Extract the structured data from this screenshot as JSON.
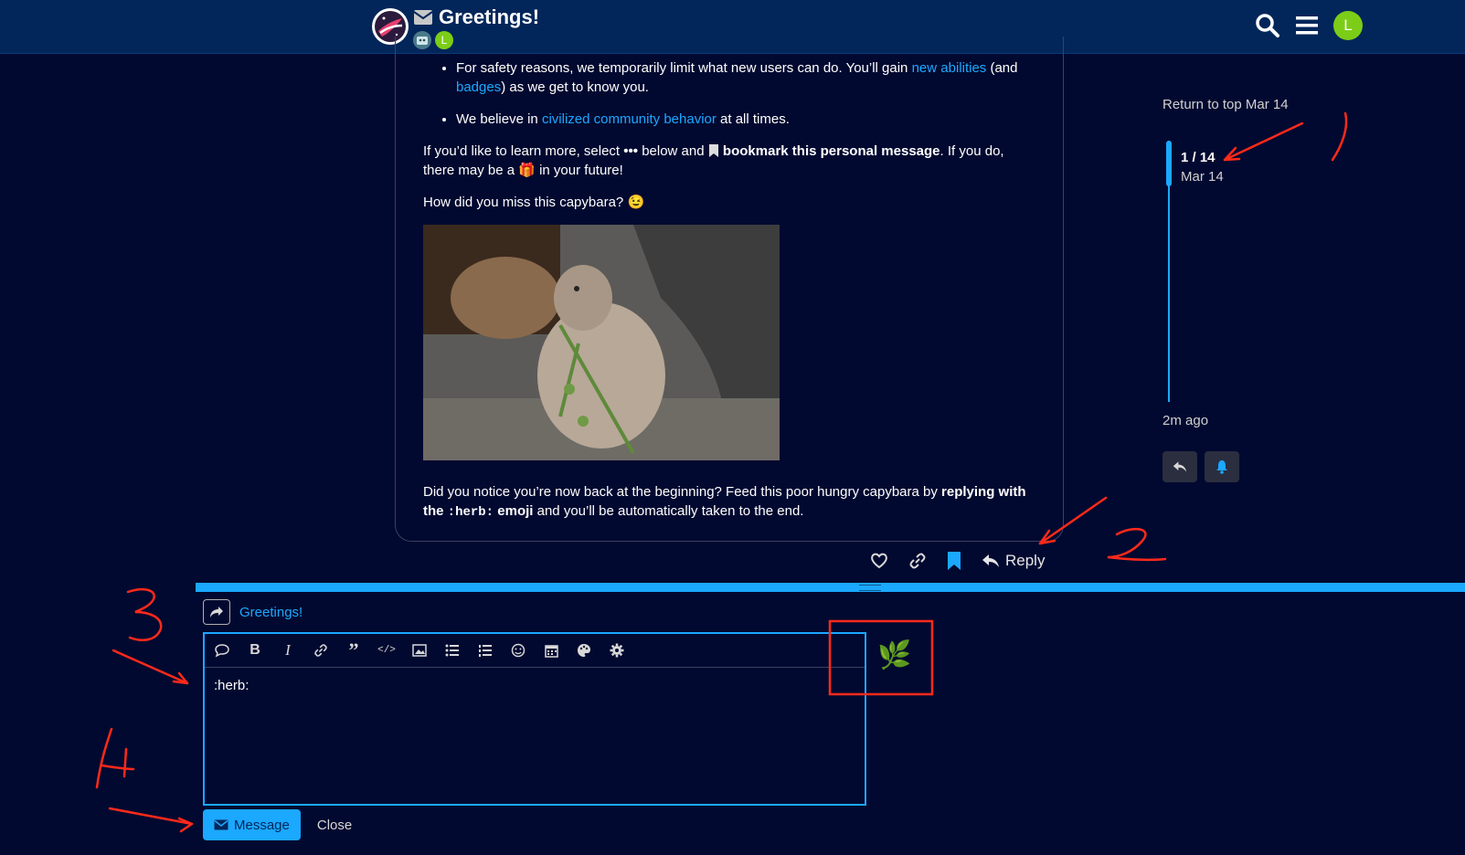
{
  "header": {
    "title": "Greetings!",
    "participant_initial": "L",
    "user_initial": "L",
    "colors": {
      "bg": "#03265a",
      "avatar": "#7ccd18"
    }
  },
  "post": {
    "li1_text": "For safety reasons, we temporarily limit what new users can do. You’ll gain ",
    "li1_link1": "new abilities",
    "li1_mid": " (and ",
    "li1_link2": "badges",
    "li1_end": ") as we get to know you.",
    "li2_text": "We believe in ",
    "li2_link": "civilized community behavior",
    "li2_end": " at all times.",
    "p1_a": "If you’d like to learn more, select ",
    "p1_dots": "•••",
    "p1_b": " below and ",
    "p1_bold": " bookmark this personal message",
    "p1_c": ". If you do, there may be a ",
    "p1_gift": "🎁",
    "p1_d": " in your future!",
    "p2": "How did you miss this capybara?",
    "p2_emoji": "😉",
    "p3_a": "Did you notice you’re now back at the beginning? Feed this poor hungry capybara by ",
    "p3_bold1": "replying with the ",
    "p3_code": ":herb:",
    "p3_bold2": " emoji",
    "p3_end": " and you’ll be automatically taken to the end."
  },
  "actions": {
    "reply_label": "Reply"
  },
  "timeline": {
    "return_label": "Return to top Mar 14",
    "position": "1 / 14",
    "date": "Mar 14",
    "ago": "2m ago"
  },
  "composer": {
    "reply_title": "Greetings!",
    "text": ":herb:",
    "preview_emoji": "🌿",
    "submit_label": "Message",
    "close_label": "Close",
    "accent": "#1ba8ff"
  },
  "annotations": [
    "1",
    "2",
    "3",
    "4"
  ]
}
